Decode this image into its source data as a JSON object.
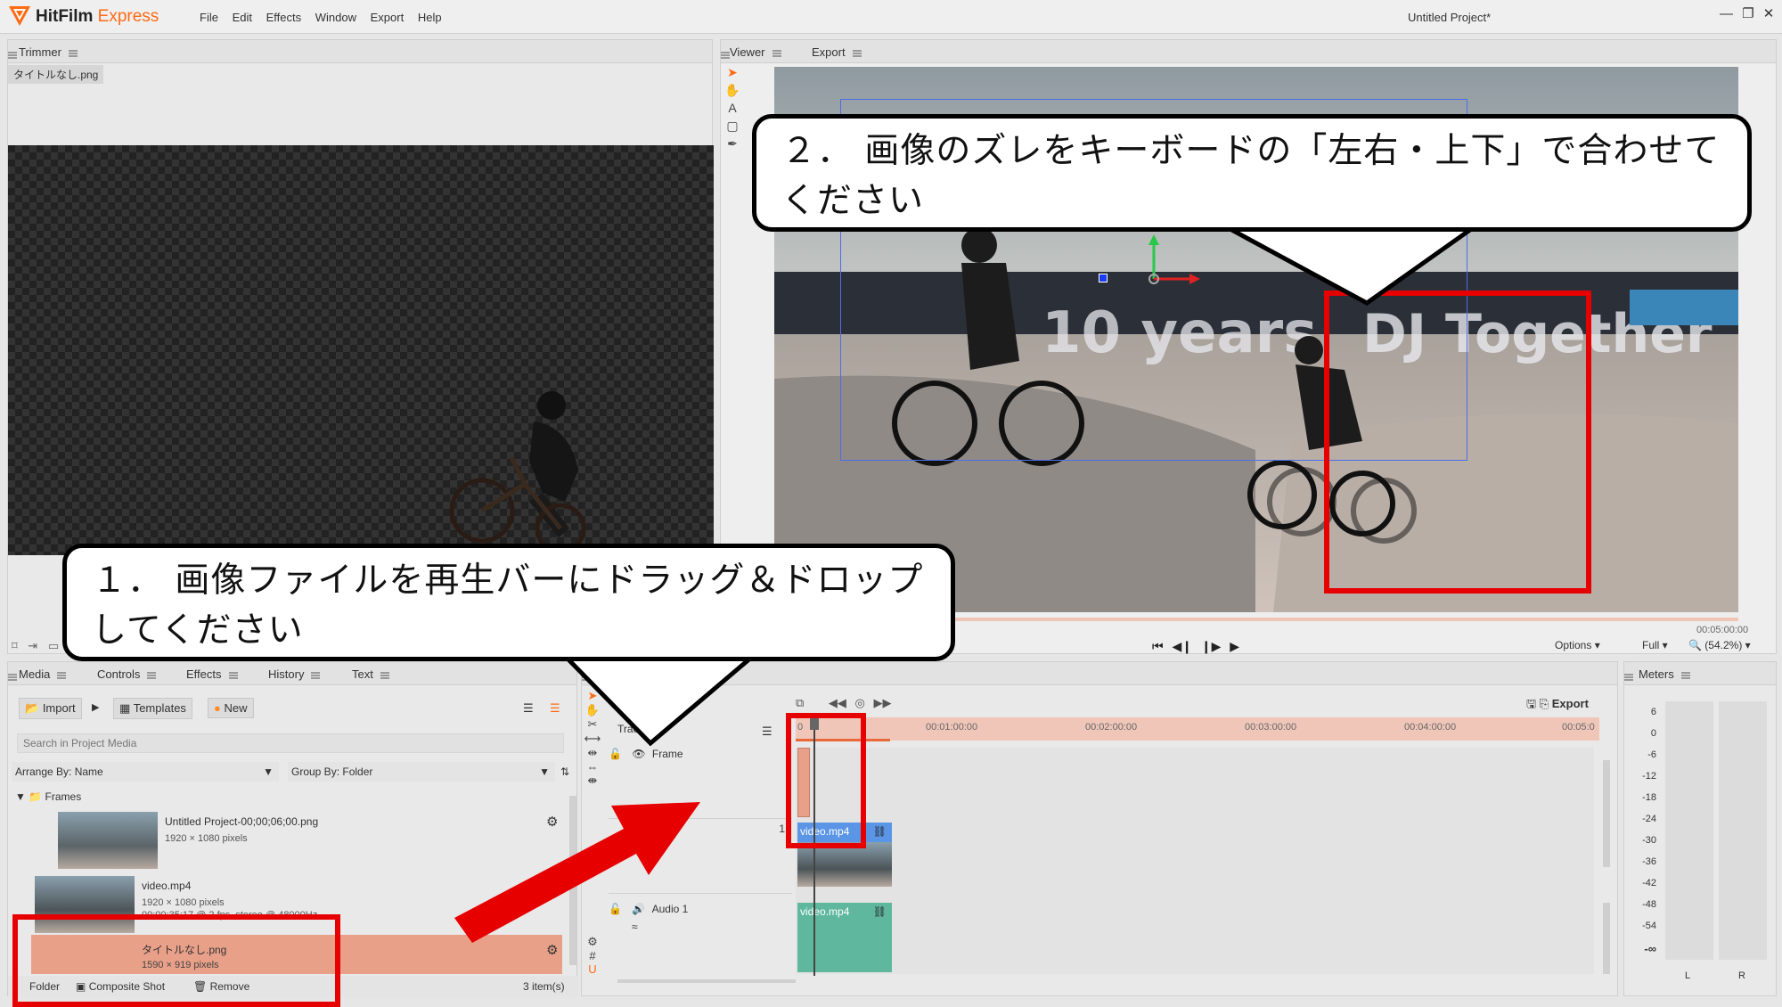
{
  "app": {
    "brand": "HitFilm",
    "edition": "Express",
    "project_title": "Untitled Project*",
    "window_controls": [
      "—",
      "❐",
      "✕"
    ]
  },
  "menu": [
    "File",
    "Edit",
    "Effects",
    "Window",
    "Export",
    "Help"
  ],
  "trimmer": {
    "tab": "Trimmer",
    "file": "タイトルなし.png"
  },
  "viewer": {
    "tabs": [
      "Viewer",
      "Export"
    ],
    "timecode": "00:05:00:00",
    "options": "Options",
    "full": "Full",
    "zoom": "(54.2%)"
  },
  "callouts": {
    "top": "２． 画像のズレをキーボードの「左右・上下」で合わせてください",
    "bottom": "１． 画像ファイルを再生バーにドラッグ＆ドロップしてください"
  },
  "media": {
    "tabs": [
      "Media",
      "Controls",
      "Effects",
      "History",
      "Text"
    ],
    "toolbar": {
      "import": "Import",
      "templates": "Templates",
      "new": "New"
    },
    "search_placeholder": "Search in Project Media",
    "arrange": "Arrange By: Name",
    "group": "Group By: Folder",
    "folder_name": "Frames",
    "items": [
      {
        "name": "Untitled Project-00;00;06;00.png",
        "dims": "1920 × 1080 pixels"
      },
      {
        "name": "video.mp4",
        "dims": "1920 × 1080 pixels",
        "extra": "00:00:35:17 @ 2 fps, stereo @ 48000Hz"
      },
      {
        "name": "タイトルなし.png",
        "dims": "1590 × 919 pixels"
      }
    ],
    "footer": {
      "folder": "Folder",
      "composite": "Composite Shot",
      "remove": "Remove",
      "count": "3 item(s)"
    }
  },
  "timeline": {
    "export": "Export",
    "track_header": "Track",
    "ticks": [
      "0",
      "00:01:00:00",
      "00:02:00:00",
      "00:03:00:00",
      "00:04:00:00",
      "00:05:0"
    ],
    "tracks": [
      {
        "name": "Frame"
      },
      {
        "name": "1"
      },
      {
        "name": "Audio 1"
      }
    ],
    "clips": {
      "video": "video.mp4",
      "audio": "video.mp4"
    }
  },
  "meters": {
    "tab": "Meters",
    "scale": [
      "6",
      "0",
      "-6",
      "-12",
      "-18",
      "-24",
      "-30",
      "-36",
      "-42",
      "-48",
      "-54",
      "-∞"
    ],
    "left": "L",
    "right": "R"
  },
  "colors": {
    "accent": "#ff6a13",
    "red": "#e60000",
    "clip_selected": "#e9a089",
    "video_clip": "#5b95e6",
    "audio_clip": "#5fb89d"
  }
}
